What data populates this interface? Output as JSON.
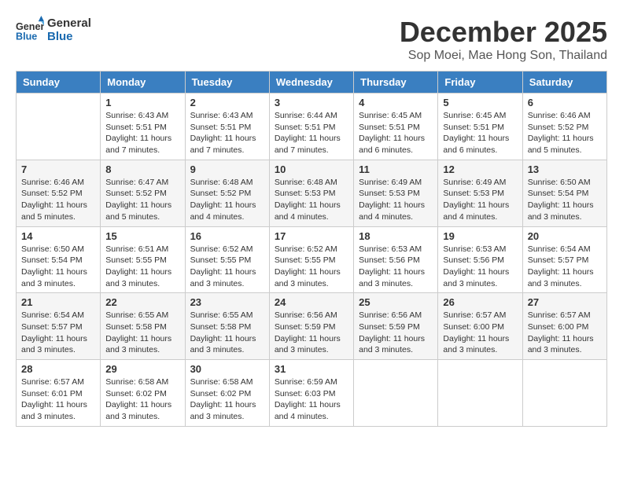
{
  "header": {
    "logo_line1": "General",
    "logo_line2": "Blue",
    "month_title": "December 2025",
    "location": "Sop Moei, Mae Hong Son, Thailand"
  },
  "weekdays": [
    "Sunday",
    "Monday",
    "Tuesday",
    "Wednesday",
    "Thursday",
    "Friday",
    "Saturday"
  ],
  "weeks": [
    [
      {
        "day": "",
        "sunrise": "",
        "sunset": "",
        "daylight": ""
      },
      {
        "day": "1",
        "sunrise": "Sunrise: 6:43 AM",
        "sunset": "Sunset: 5:51 PM",
        "daylight": "Daylight: 11 hours and 7 minutes."
      },
      {
        "day": "2",
        "sunrise": "Sunrise: 6:43 AM",
        "sunset": "Sunset: 5:51 PM",
        "daylight": "Daylight: 11 hours and 7 minutes."
      },
      {
        "day": "3",
        "sunrise": "Sunrise: 6:44 AM",
        "sunset": "Sunset: 5:51 PM",
        "daylight": "Daylight: 11 hours and 7 minutes."
      },
      {
        "day": "4",
        "sunrise": "Sunrise: 6:45 AM",
        "sunset": "Sunset: 5:51 PM",
        "daylight": "Daylight: 11 hours and 6 minutes."
      },
      {
        "day": "5",
        "sunrise": "Sunrise: 6:45 AM",
        "sunset": "Sunset: 5:51 PM",
        "daylight": "Daylight: 11 hours and 6 minutes."
      },
      {
        "day": "6",
        "sunrise": "Sunrise: 6:46 AM",
        "sunset": "Sunset: 5:52 PM",
        "daylight": "Daylight: 11 hours and 5 minutes."
      }
    ],
    [
      {
        "day": "7",
        "sunrise": "Sunrise: 6:46 AM",
        "sunset": "Sunset: 5:52 PM",
        "daylight": "Daylight: 11 hours and 5 minutes."
      },
      {
        "day": "8",
        "sunrise": "Sunrise: 6:47 AM",
        "sunset": "Sunset: 5:52 PM",
        "daylight": "Daylight: 11 hours and 5 minutes."
      },
      {
        "day": "9",
        "sunrise": "Sunrise: 6:48 AM",
        "sunset": "Sunset: 5:52 PM",
        "daylight": "Daylight: 11 hours and 4 minutes."
      },
      {
        "day": "10",
        "sunrise": "Sunrise: 6:48 AM",
        "sunset": "Sunset: 5:53 PM",
        "daylight": "Daylight: 11 hours and 4 minutes."
      },
      {
        "day": "11",
        "sunrise": "Sunrise: 6:49 AM",
        "sunset": "Sunset: 5:53 PM",
        "daylight": "Daylight: 11 hours and 4 minutes."
      },
      {
        "day": "12",
        "sunrise": "Sunrise: 6:49 AM",
        "sunset": "Sunset: 5:53 PM",
        "daylight": "Daylight: 11 hours and 4 minutes."
      },
      {
        "day": "13",
        "sunrise": "Sunrise: 6:50 AM",
        "sunset": "Sunset: 5:54 PM",
        "daylight": "Daylight: 11 hours and 3 minutes."
      }
    ],
    [
      {
        "day": "14",
        "sunrise": "Sunrise: 6:50 AM",
        "sunset": "Sunset: 5:54 PM",
        "daylight": "Daylight: 11 hours and 3 minutes."
      },
      {
        "day": "15",
        "sunrise": "Sunrise: 6:51 AM",
        "sunset": "Sunset: 5:55 PM",
        "daylight": "Daylight: 11 hours and 3 minutes."
      },
      {
        "day": "16",
        "sunrise": "Sunrise: 6:52 AM",
        "sunset": "Sunset: 5:55 PM",
        "daylight": "Daylight: 11 hours and 3 minutes."
      },
      {
        "day": "17",
        "sunrise": "Sunrise: 6:52 AM",
        "sunset": "Sunset: 5:55 PM",
        "daylight": "Daylight: 11 hours and 3 minutes."
      },
      {
        "day": "18",
        "sunrise": "Sunrise: 6:53 AM",
        "sunset": "Sunset: 5:56 PM",
        "daylight": "Daylight: 11 hours and 3 minutes."
      },
      {
        "day": "19",
        "sunrise": "Sunrise: 6:53 AM",
        "sunset": "Sunset: 5:56 PM",
        "daylight": "Daylight: 11 hours and 3 minutes."
      },
      {
        "day": "20",
        "sunrise": "Sunrise: 6:54 AM",
        "sunset": "Sunset: 5:57 PM",
        "daylight": "Daylight: 11 hours and 3 minutes."
      }
    ],
    [
      {
        "day": "21",
        "sunrise": "Sunrise: 6:54 AM",
        "sunset": "Sunset: 5:57 PM",
        "daylight": "Daylight: 11 hours and 3 minutes."
      },
      {
        "day": "22",
        "sunrise": "Sunrise: 6:55 AM",
        "sunset": "Sunset: 5:58 PM",
        "daylight": "Daylight: 11 hours and 3 minutes."
      },
      {
        "day": "23",
        "sunrise": "Sunrise: 6:55 AM",
        "sunset": "Sunset: 5:58 PM",
        "daylight": "Daylight: 11 hours and 3 minutes."
      },
      {
        "day": "24",
        "sunrise": "Sunrise: 6:56 AM",
        "sunset": "Sunset: 5:59 PM",
        "daylight": "Daylight: 11 hours and 3 minutes."
      },
      {
        "day": "25",
        "sunrise": "Sunrise: 6:56 AM",
        "sunset": "Sunset: 5:59 PM",
        "daylight": "Daylight: 11 hours and 3 minutes."
      },
      {
        "day": "26",
        "sunrise": "Sunrise: 6:57 AM",
        "sunset": "Sunset: 6:00 PM",
        "daylight": "Daylight: 11 hours and 3 minutes."
      },
      {
        "day": "27",
        "sunrise": "Sunrise: 6:57 AM",
        "sunset": "Sunset: 6:00 PM",
        "daylight": "Daylight: 11 hours and 3 minutes."
      }
    ],
    [
      {
        "day": "28",
        "sunrise": "Sunrise: 6:57 AM",
        "sunset": "Sunset: 6:01 PM",
        "daylight": "Daylight: 11 hours and 3 minutes."
      },
      {
        "day": "29",
        "sunrise": "Sunrise: 6:58 AM",
        "sunset": "Sunset: 6:02 PM",
        "daylight": "Daylight: 11 hours and 3 minutes."
      },
      {
        "day": "30",
        "sunrise": "Sunrise: 6:58 AM",
        "sunset": "Sunset: 6:02 PM",
        "daylight": "Daylight: 11 hours and 3 minutes."
      },
      {
        "day": "31",
        "sunrise": "Sunrise: 6:59 AM",
        "sunset": "Sunset: 6:03 PM",
        "daylight": "Daylight: 11 hours and 4 minutes."
      },
      {
        "day": "",
        "sunrise": "",
        "sunset": "",
        "daylight": ""
      },
      {
        "day": "",
        "sunrise": "",
        "sunset": "",
        "daylight": ""
      },
      {
        "day": "",
        "sunrise": "",
        "sunset": "",
        "daylight": ""
      }
    ]
  ]
}
